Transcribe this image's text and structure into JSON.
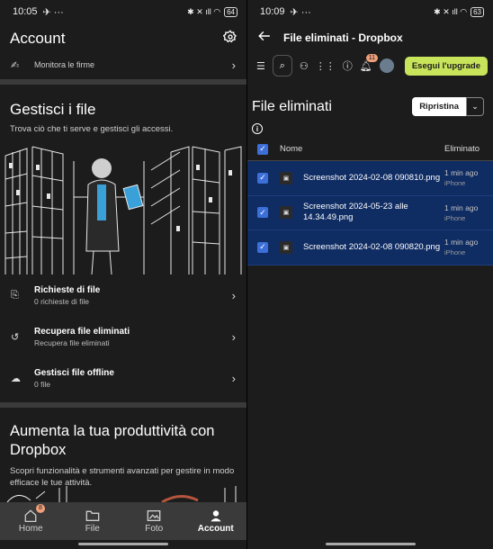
{
  "left": {
    "status": {
      "time": "10:05",
      "icons": "✈ ···",
      "right_icons": "✱ ✕ ıll ◠",
      "battery": "64"
    },
    "title": "Account",
    "firma_row": {
      "label": "Monitora le firme"
    },
    "gestisci": {
      "title": "Gestisci i file",
      "subtitle": "Trova ciò che ti serve e gestisci gli accessi."
    },
    "menu": [
      {
        "title": "Richieste di file",
        "subtitle": "0 richieste di file",
        "icon": "file-request-icon"
      },
      {
        "title": "Recupera file eliminati",
        "subtitle": "Recupera file eliminati",
        "icon": "restore-file-icon"
      },
      {
        "title": "Gestisci file offline",
        "subtitle": "0 file",
        "icon": "offline-cloud-icon"
      }
    ],
    "aumenta": {
      "title": "Aumenta la tua produttività con Dropbox",
      "subtitle": "Scopri funzionalità e strumenti avanzati per gestire in modo efficace le tue attività."
    },
    "nav": [
      {
        "label": "Home",
        "badge": "8"
      },
      {
        "label": "File"
      },
      {
        "label": "Foto"
      },
      {
        "label": "Account"
      }
    ]
  },
  "right": {
    "status": {
      "time": "10:09",
      "icons": "✈ ···",
      "right_icons": "✱ ✕ ıll ◠",
      "battery": "63"
    },
    "title": "File eliminati - Dropbox",
    "toolbar": {
      "notif_badge": "11",
      "upgrade": "Esegui l'upgrade"
    },
    "heading": "File eliminati",
    "restore": "Ripristina",
    "columns": {
      "name": "Nome",
      "deleted": "Eliminato"
    },
    "files": [
      {
        "name": "Screenshot 2024-02-08 090810.png",
        "when": "1 min ago",
        "device": "iPhone"
      },
      {
        "name": "Screenshot 2024-05-23 alle 14.34.49.png",
        "when": "1 min ago",
        "device": "iPhone"
      },
      {
        "name": "Screenshot 2024-02-08 090820.png",
        "when": "1 min ago",
        "device": "iPhone"
      }
    ],
    "colors": {
      "accent": "#c8e45a",
      "selected_row": "#0f2c63",
      "checkbox": "#3d6fd9"
    }
  }
}
